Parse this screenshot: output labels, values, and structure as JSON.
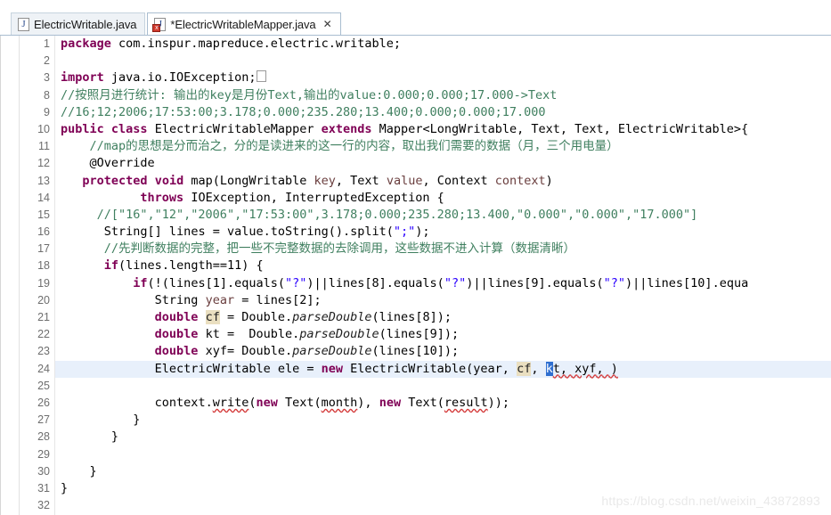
{
  "window": {
    "app": "Eclipse IDE Java Editor"
  },
  "tabs": [
    {
      "label": "ElectricWritable.java",
      "icon": "java-file-icon",
      "active": false,
      "dirty": false,
      "error": false,
      "closable": false
    },
    {
      "label": "*ElectricWritableMapper.java",
      "icon": "java-file-error-icon",
      "active": true,
      "dirty": true,
      "error": true,
      "closable": true,
      "close_glyph": "✕"
    }
  ],
  "editor": {
    "first_visible_line": 1,
    "current_line": 24,
    "error_lines": [
      24,
      26
    ],
    "override_marker_line": 13,
    "fold_marker_lines": [
      3,
      12
    ],
    "occurrence_highlight": "cf",
    "cursor_selection": "k",
    "lines": [
      {
        "num": "1",
        "indent": 0
      },
      {
        "num": "2",
        "indent": 0
      },
      {
        "num": "3",
        "indent": 0
      },
      {
        "num": "8",
        "indent": 0
      },
      {
        "num": "9",
        "indent": 0
      },
      {
        "num": "10",
        "indent": 0
      },
      {
        "num": "11",
        "indent": 0
      },
      {
        "num": "12",
        "indent": 0
      },
      {
        "num": "13",
        "indent": 0
      },
      {
        "num": "14",
        "indent": 0
      },
      {
        "num": "15",
        "indent": 0
      },
      {
        "num": "16",
        "indent": 0
      },
      {
        "num": "17",
        "indent": 0
      },
      {
        "num": "18",
        "indent": 0
      },
      {
        "num": "19",
        "indent": 0
      },
      {
        "num": "20",
        "indent": 0
      },
      {
        "num": "21",
        "indent": 0
      },
      {
        "num": "22",
        "indent": 0
      },
      {
        "num": "23",
        "indent": 0
      },
      {
        "num": "24",
        "indent": 0
      },
      {
        "num": "25",
        "indent": 0
      },
      {
        "num": "26",
        "indent": 0
      },
      {
        "num": "27",
        "indent": 0
      },
      {
        "num": "28",
        "indent": 0
      },
      {
        "num": "29",
        "indent": 0
      },
      {
        "num": "30",
        "indent": 0
      },
      {
        "num": "31",
        "indent": 0
      },
      {
        "num": "32",
        "indent": 0
      }
    ],
    "code": {
      "l1_kw": "package",
      "l1_rest": " com.inspur.mapreduce.electric.writable;",
      "l3_kw": "import",
      "l3_rest": " java.io.IOException;",
      "l8": "//按照月进行统计: 输出的key是月份Text,输出的value:0.000;0.000;17.000->Text",
      "l9": "//16;12;2006;17:53:00;3.178;0.000;235.280;13.400;0.000;0.000;17.000",
      "l10_kw1": "public",
      "l10_kw2": "class",
      "l10_name": " ElectricWritableMapper ",
      "l10_kw3": "extends",
      "l10_rest": " Mapper<LongWritable, Text, Text, ElectricWritable>{",
      "l11": "//map的思想是分而治之，分的是读进来的这一行的内容，取出我们需要的数据（月，三个用电量）",
      "l12": "@Override",
      "l13_kw1": "protected",
      "l13_kw2": "void",
      "l13_sig_a": " map(LongWritable ",
      "l13_p1": "key",
      "l13_sig_b": ", Text ",
      "l13_p2": "value",
      "l13_sig_c": ", Context ",
      "l13_p3": "context",
      "l13_sig_d": ")",
      "l14_kw": "throws",
      "l14_rest": " IOException, InterruptedException {",
      "l15": "//[\"16\",\"12\",\"2006\",\"17:53:00\",3.178;0.000;235.280;13.400,\"0.000\",\"0.000\",\"17.000\"]",
      "l16_a": "String[] lines = value.toString().split(",
      "l16_str": "\";\"",
      "l16_b": ");",
      "l17": "//先判断数据的完整，把一些不完整数据的去除调用，这些数据不进入计算（数据清晰）",
      "l18_kw": "if",
      "l18_rest": "(lines.length==11) {",
      "l19_kw": "if",
      "l19_a": "(!(lines[1].equals(",
      "l19_s1": "\"?\"",
      "l19_b": ")||lines[8].equals(",
      "l19_s2": "\"?\"",
      "l19_c": ")||lines[9].equals(",
      "l19_s3": "\"?\"",
      "l19_d": ")||lines[10].equa",
      "l20_a": "String ",
      "l20_var": "year",
      "l20_b": " = lines[2];",
      "l21_kw": "double",
      "l21_var": "cf",
      "l21_a": " = Double.",
      "l21_m": "parseDouble",
      "l21_b": "(lines[8]);",
      "l22_kw": "double",
      "l22_var": "kt",
      "l22_a": " =  Double.",
      "l22_m": "parseDouble",
      "l22_b": "(lines[9]);",
      "l23_kw": "double",
      "l23_var": "xyf",
      "l23_a": "= Double.",
      "l23_m": "parseDouble",
      "l23_b": "(lines[10]);",
      "l24_a": "ElectricWritable ele = ",
      "l24_kw": "new",
      "l24_b": " ElectricWritable(year, ",
      "l24_occ": "cf",
      "l24_c": ", ",
      "l24_sel": "k",
      "l24_d": "t, xyf, )",
      "l26_a": "context.",
      "l26_m": "write",
      "l26_b": "(",
      "l26_kw1": "new",
      "l26_c": " Text(",
      "l26_v1": "month",
      "l26_d": "), ",
      "l26_kw2": "new",
      "l26_e": " Text(",
      "l26_v2": "result",
      "l26_f": "));",
      "l27": "}",
      "l28": "}",
      "l30": "}",
      "l31": "}"
    }
  },
  "watermark": {
    "text": "https://blog.csdn.net/weixin_43872893"
  },
  "colors": {
    "keyword": "#7f0055",
    "comment": "#3f7f5f",
    "string": "#2a00ff",
    "field": "#0000c0",
    "local_var": "#6a3e3e",
    "current_line_bg": "#e8f0fb",
    "occurrence_bg": "#eadfc0",
    "selection_bg": "#2f6fd0",
    "error_marker": "#d9342b",
    "diff_bar": "#3aa8cc"
  }
}
